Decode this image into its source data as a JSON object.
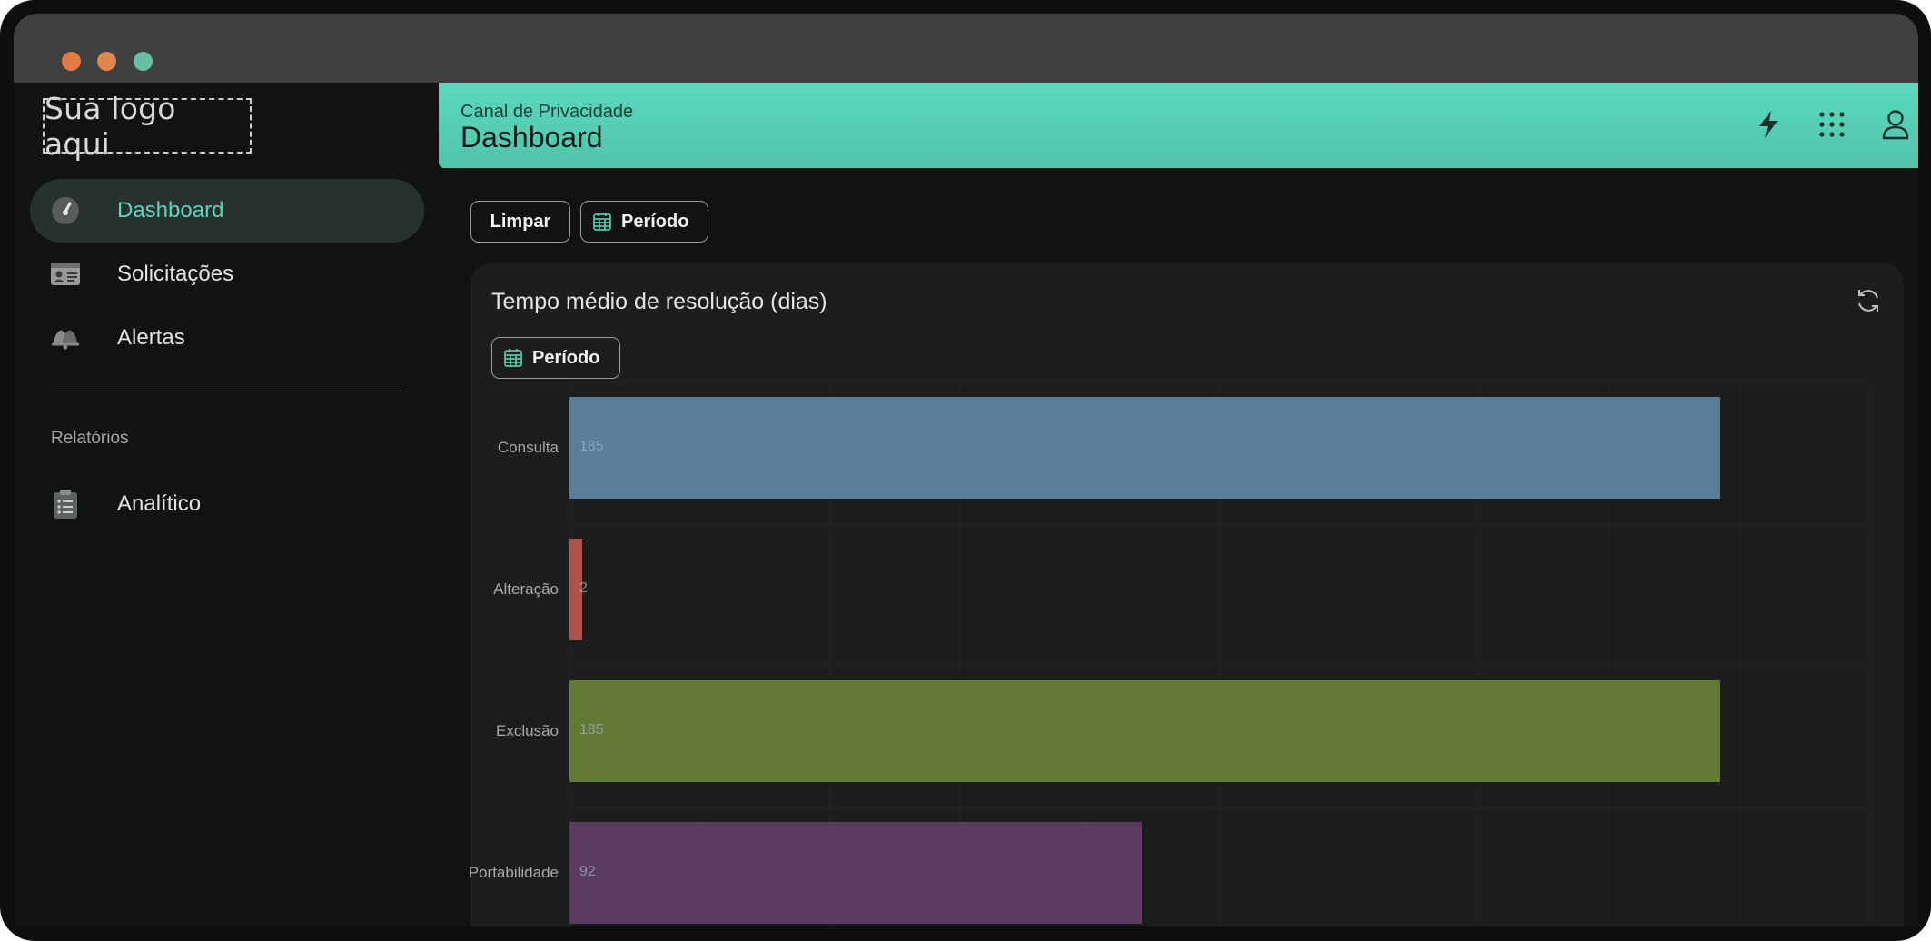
{
  "window": {
    "dots": [
      {
        "name": "close",
        "color": "#e27a48"
      },
      {
        "name": "minimize",
        "color": "#e2864a"
      },
      {
        "name": "maximize",
        "color": "#6bbea6"
      }
    ]
  },
  "sidebar": {
    "logo": "Sua logo aqui",
    "items": [
      {
        "label": "Dashboard",
        "icon": "speedometer-icon",
        "active": true
      },
      {
        "label": "Solicitações",
        "icon": "id-card-icon",
        "active": false
      },
      {
        "label": "Alertas",
        "icon": "bell-icon",
        "active": false
      }
    ],
    "section": "Relatórios",
    "reports": [
      {
        "label": "Analítico",
        "icon": "clipboard-icon"
      }
    ]
  },
  "header": {
    "breadcrumb": "Canal de Privacidade",
    "title": "Dashboard",
    "icons": [
      "lightning-icon",
      "apps-grid-icon",
      "user-icon"
    ]
  },
  "toolbar": {
    "clear_label": "Limpar",
    "period_label": "Período"
  },
  "card": {
    "title": "Tempo médio de resolução (dias)",
    "period_label": "Período"
  },
  "colors": {
    "accent": "#5bd7b6",
    "header": "#54cdb4"
  },
  "chart_data": {
    "type": "bar",
    "orientation": "horizontal",
    "categories": [
      "Consulta",
      "Alteração",
      "Exclusão",
      "Portabilidade"
    ],
    "values": [
      185,
      2,
      185,
      92
    ],
    "colors": [
      "#5a7d9a",
      "#b0524b",
      "#637a37",
      "#5a3c5e"
    ],
    "xlim": [
      0,
      200
    ],
    "grid": true
  }
}
